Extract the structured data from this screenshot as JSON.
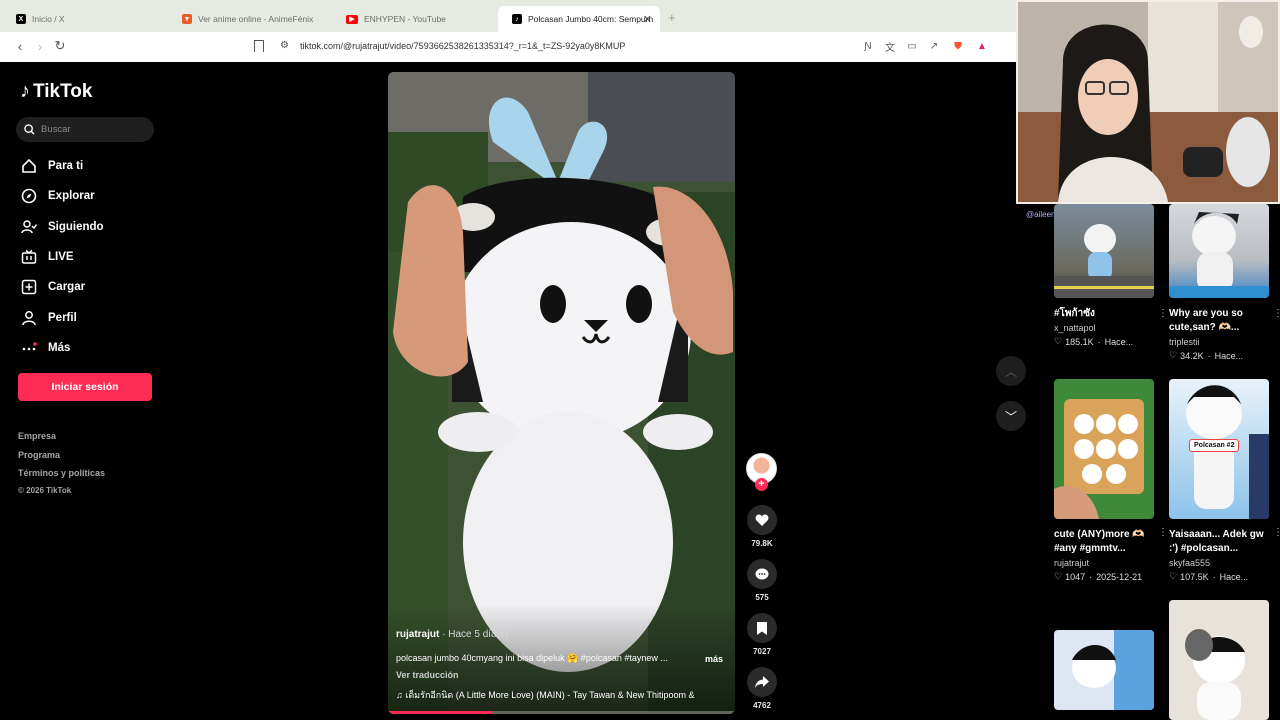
{
  "browser": {
    "tabs": [
      {
        "label": "Inicio / X",
        "icon": "x-logo-icon",
        "color": "#000000"
      },
      {
        "label": "Ver anime online - AnimeFénix",
        "icon": "animefenix-icon",
        "color": "#e85d2a"
      },
      {
        "label": "ENHYPEN - YouTube",
        "icon": "youtube-icon",
        "color": "#ff0000"
      },
      {
        "label": "Polcasan Jumbo 40cm: Sempurn",
        "icon": "tiktok-icon",
        "color": "#000000"
      }
    ],
    "url": "tiktok.com/@rujatrajut/video/7593662538261335314?_r=1&_t=ZS-92ya0y8KMUP"
  },
  "tiktok": {
    "logo": "TikTok",
    "search_placeholder": "Buscar",
    "nav": [
      {
        "label": "Para ti",
        "icon": "home-icon"
      },
      {
        "label": "Explorar",
        "icon": "compass-icon"
      },
      {
        "label": "Siguiendo",
        "icon": "following-icon"
      },
      {
        "label": "LIVE",
        "icon": "live-icon"
      },
      {
        "label": "Cargar",
        "icon": "upload-icon"
      },
      {
        "label": "Perfil",
        "icon": "profile-icon"
      },
      {
        "label": "Más",
        "icon": "more-icon"
      }
    ],
    "login_label": "Iniciar sesión",
    "footer": [
      "Empresa",
      "Programa",
      "Términos y políticas",
      "© 2026 TikTok"
    ],
    "accent": "#fe2c55"
  },
  "video": {
    "author": "rujatrajut",
    "time": " · Hace 5 día(s)",
    "description": "polcasan jumbo 40cmyang ini bisa dipeluk 🤗 #polcasan #taynew ...",
    "more": "más",
    "translate": "Ver traducción",
    "music": "♫  เด็มรักอีกนิด (A Little More Love) (MAIN) - Tay Tawan & New Thitipoom &",
    "progress": 0.3
  },
  "actions": {
    "likes": "79.8K",
    "comments": "575",
    "saves": "7027",
    "shares": "4762"
  },
  "recommendations": [
    {
      "title": "#โพก้าซัง",
      "author": "x_nattapol",
      "likes": "185.1K",
      "date": "Hace..."
    },
    {
      "title": "Why are you so cute,san? 🫶🏻...",
      "author": "triplestii",
      "likes": "34.2K",
      "date": "Hace..."
    },
    {
      "title": "cute (ANY)more 🫶🏻 #any #gmmtv...",
      "author": "rujatrajut",
      "likes": "1047",
      "date": "2025-12-21"
    },
    {
      "title": "Yaisaaan... Adek gw :') #polcasan...",
      "author": "skyfaa555",
      "likes": "107.5K",
      "date": "Hace..."
    },
    {
      "title": "",
      "author": "",
      "likes": "",
      "date": ""
    },
    {
      "title": "",
      "author": "",
      "likes": "",
      "date": ""
    }
  ],
  "thumb_label": "Polcasan #2",
  "webcam_tag": "@aileen"
}
